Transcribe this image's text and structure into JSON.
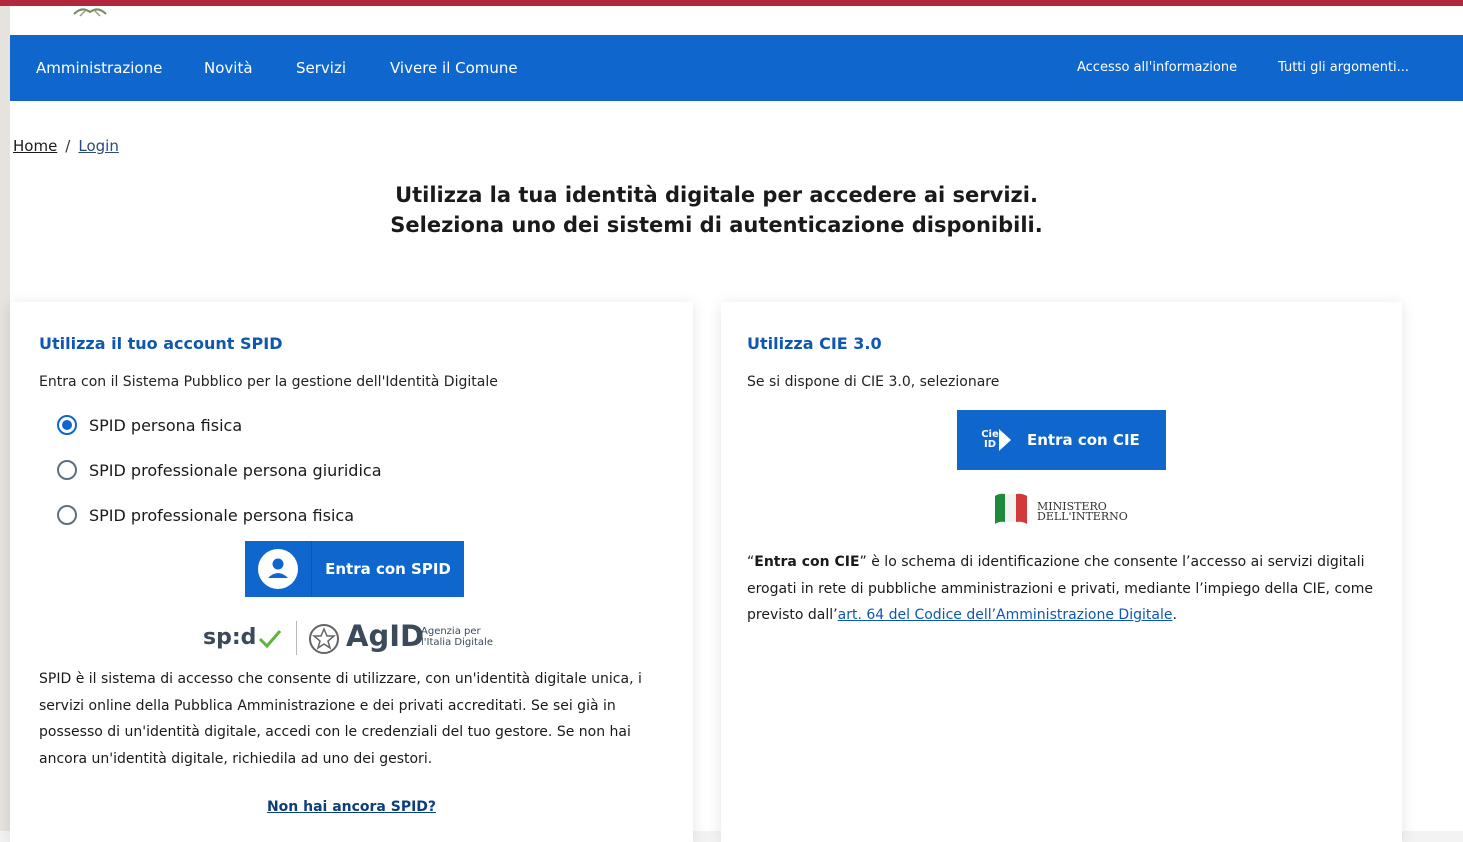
{
  "nav": {
    "items": [
      "Amministrazione",
      "Novità",
      "Servizi",
      "Vivere il Comune"
    ],
    "right_items": [
      "Accesso all'informazione",
      "Tutti gli argomenti..."
    ]
  },
  "breadcrumb": {
    "home": "Home",
    "separator": "/",
    "current": "Login"
  },
  "headline": {
    "line1": "Utilizza la tua identità digitale per accedere ai servizi.",
    "line2": "Seleziona uno dei sistemi di autenticazione disponibili."
  },
  "spid": {
    "title": "Utilizza il tuo account SPID",
    "subtitle": "Entra con il Sistema Pubblico per la gestione dell'Identità Digitale",
    "options": [
      {
        "label": "SPID persona fisica",
        "selected": true
      },
      {
        "label": "SPID professionale persona giuridica",
        "selected": false
      },
      {
        "label": "SPID professionale persona fisica",
        "selected": false
      }
    ],
    "button_label": "Entra con SPID",
    "logo_spid": "sp:d",
    "logo_agid": "AgID",
    "agid_line1": "Agenzia per",
    "agid_line2": "l'Italia Digitale",
    "description": "SPID è il sistema di accesso che consente di utilizzare, con un'identità digitale unica, i servizi online della Pubblica Amministrazione e dei privati accreditati. Se sei già in possesso di un'identità digitale, accedi con le credenziali del tuo gestore. Se non hai ancora un'identità digitale, richiedila ad uno dei gestori.",
    "help_link": "Non hai ancora SPID?"
  },
  "cie": {
    "title": "Utilizza CIE 3.0",
    "subtitle": "Se si dispone di CIE 3.0, selezionare",
    "button_label": "Entra con CIE",
    "icon_text": "Cie ID",
    "ministry_line1": "MINISTERO",
    "ministry_line2": "DELL'INTERNO",
    "desc_open_quote": "“",
    "desc_bold": "Entra con CIE",
    "desc_rest": "” è lo schema di identificazione che consente l’accesso ai servizi digitali erogati in rete di pubbliche amministrazioni e privati, mediante l’impiego della CIE, come previsto dall’",
    "desc_link": "art. 64 del Codice dell’Amministrazione Digitale",
    "desc_end": "."
  },
  "colors": {
    "primary": "#0f66cc",
    "title_blue": "#0f57b3",
    "top_accent": "#b3273d",
    "spid_check": "#5fb341"
  }
}
